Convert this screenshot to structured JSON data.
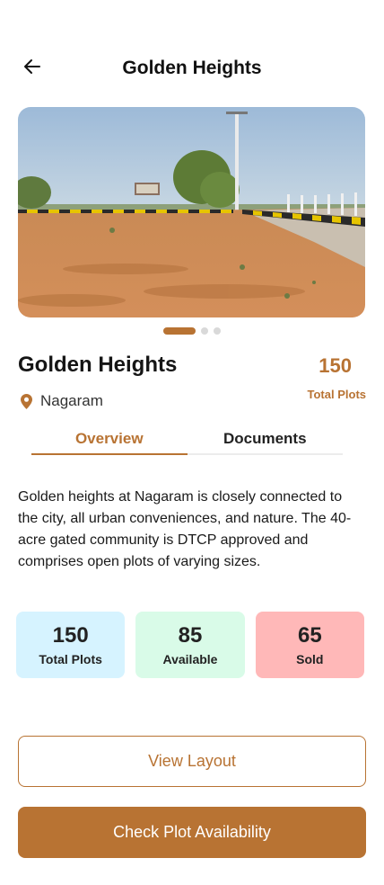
{
  "header": {
    "title": "Golden Heights",
    "back_icon": "arrow-left-icon"
  },
  "gallery": {
    "slide_count": 3,
    "active_index": 0
  },
  "property": {
    "name": "Golden Heights",
    "location": "Nagaram",
    "location_icon": "map-pin-icon",
    "total_plots_value": "150",
    "total_plots_label": "Total Plots"
  },
  "tabs": [
    {
      "label": "Overview",
      "active": true
    },
    {
      "label": "Documents",
      "active": false
    }
  ],
  "overview": {
    "description": "Golden heights at Nagaram is closely connected to the city, all urban conveniences, and nature. The 40-acre gated community is DTCP approved and comprises open plots of varying sizes."
  },
  "stats": [
    {
      "value": "150",
      "label": "Total Plots",
      "color": "#d6f3ff"
    },
    {
      "value": "85",
      "label": "Available",
      "color": "#d9fbe8"
    },
    {
      "value": "65",
      "label": "Sold",
      "color": "#ffb8b8"
    }
  ],
  "actions": {
    "view_layout": "View Layout",
    "check_availability": "Check Plot Availability"
  },
  "colors": {
    "accent": "#b87333"
  }
}
